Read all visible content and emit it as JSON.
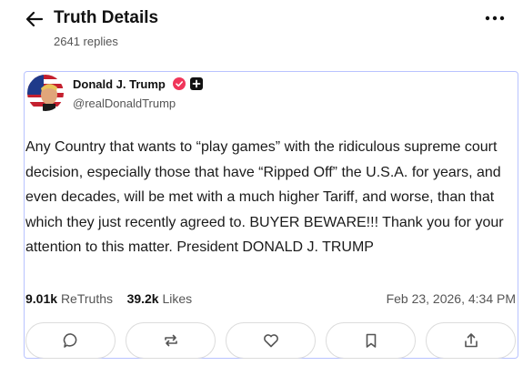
{
  "header": {
    "title": "Truth Details",
    "subtitle": "2641 replies",
    "back_icon": "arrow-left-icon",
    "more_icon": "more-horizontal-icon"
  },
  "post": {
    "author": {
      "name": "Donald J. Trump",
      "handle": "@realDonaldTrump",
      "verified_color": "#f0365a"
    },
    "text": "Any Country that wants to “play games” with the ridiculous supreme court decision, especially those that have “Ripped Off” the U.S.A. for years, and even decades, will be met with a much higher Tariff, and worse, than that which they just recently agreed to. BUYER BEWARE!!! Thank you for your attention to this matter. President DONALD J. TRUMP",
    "stats": {
      "retruths_count": "9.01k",
      "retruths_label": "ReTruths",
      "likes_count": "39.2k",
      "likes_label": "Likes",
      "timestamp": "Feb 23, 2026, 4:34 PM"
    },
    "actions": [
      "reply-icon",
      "retruth-icon",
      "like-icon",
      "bookmark-icon",
      "share-icon"
    ]
  },
  "colors": {
    "card_border": "#b9c3ff",
    "text": "#1a1a1a",
    "muted": "#555555"
  }
}
